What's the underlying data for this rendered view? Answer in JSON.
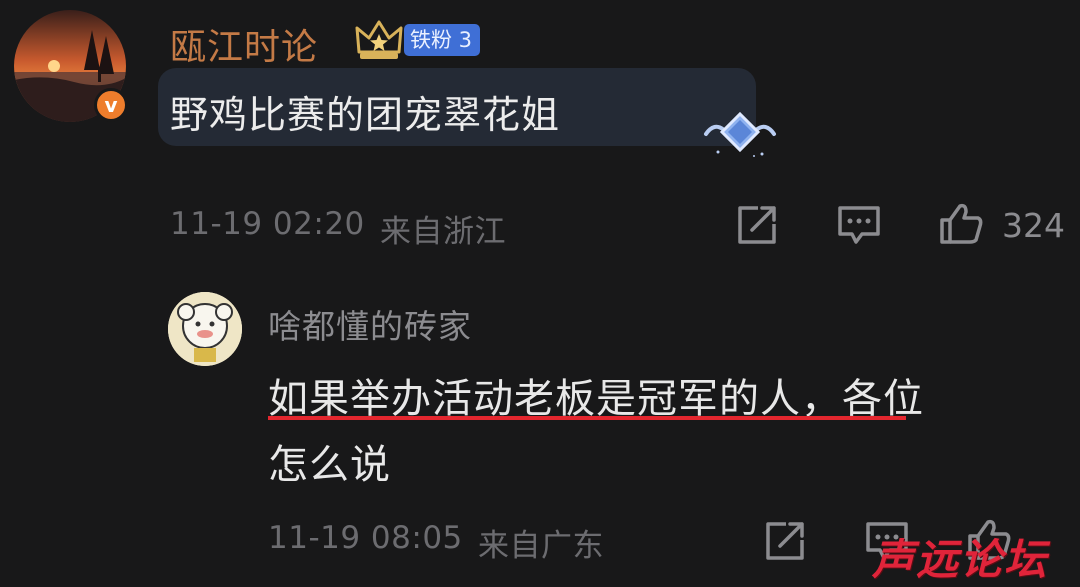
{
  "comment": {
    "username": "瓯江时论",
    "fan_badge": "铁粉 3",
    "verified_mark": "v",
    "text": "野鸡比赛的团宠翠花姐",
    "timestamp": "11-19 02:20",
    "location": "来自浙江",
    "likes": "324"
  },
  "reply": {
    "username": "啥都懂的砖家",
    "text_line1": "如果举办活动老板是冠军的人，各位",
    "text_line2": "怎么说",
    "timestamp": "11-19 08:05",
    "location": "来自广东"
  },
  "watermark": "声远论坛",
  "colors": {
    "background": "#181819",
    "username_orange": "#c47a46",
    "badge_blue": "#3f6fd6",
    "underline_red": "#e3262e"
  }
}
